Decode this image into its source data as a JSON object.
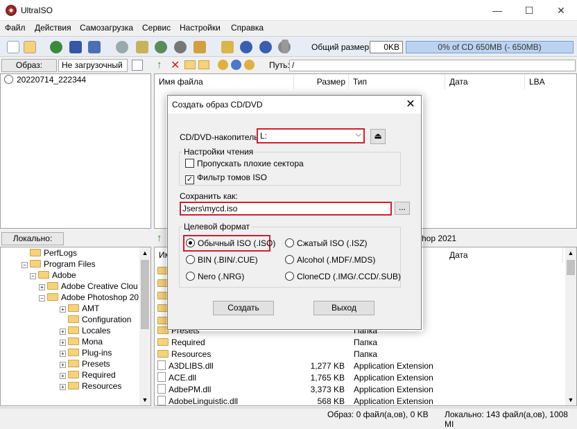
{
  "window": {
    "title": "UltraISO",
    "minimize": "—",
    "maximize": "☐",
    "close": "✕"
  },
  "menu": [
    "Файл",
    "Действия",
    "Самозагрузка",
    "Сервис",
    "Настройки",
    "Справка"
  ],
  "toolbar": {
    "size_label": "Общий размер:",
    "size_value": "0KB",
    "progress_text": "0% of CD 650MB (- 650MB)"
  },
  "image_bar": {
    "label": "Образ:",
    "value": "Не загрузочный"
  },
  "path_bar": {
    "label": "Путь:",
    "value": "/"
  },
  "left_tree": {
    "root": "20220714_222344"
  },
  "right_columns": [
    "Имя файла",
    "Размер",
    "Тип",
    "Дата",
    "LBA"
  ],
  "local": {
    "label": "Локально:",
    "tree": [
      {
        "label": "PerfLogs",
        "expander": ""
      },
      {
        "label": "Program Files",
        "expander": "−"
      },
      {
        "label": "Adobe",
        "expander": "−"
      },
      {
        "label": "Adobe Creative Clou",
        "expander": "+"
      },
      {
        "label": "Adobe Photoshop 20",
        "expander": "−"
      },
      {
        "label": "AMT",
        "expander": "+"
      },
      {
        "label": "Configuration",
        "expander": ""
      },
      {
        "label": "Locales",
        "expander": "+"
      },
      {
        "label": "Mona",
        "expander": "+"
      },
      {
        "label": "Plug-ins",
        "expander": "+"
      },
      {
        "label": "Presets",
        "expander": "+"
      },
      {
        "label": "Required",
        "expander": "+"
      },
      {
        "label": "Resources",
        "expander": "+"
      }
    ],
    "path_partial": "hop 2021",
    "columns": [
      "Им",
      "Дата"
    ],
    "files": [
      {
        "name": "Presets",
        "size": "",
        "type": "Папка",
        "icon": "folder"
      },
      {
        "name": "Required",
        "size": "",
        "type": "Папка",
        "icon": "folder"
      },
      {
        "name": "Resources",
        "size": "",
        "type": "Папка",
        "icon": "folder"
      },
      {
        "name": "A3DLIBS.dll",
        "size": "1,277 KB",
        "type": "Application Extension",
        "icon": "file"
      },
      {
        "name": "ACE.dll",
        "size": "1,765 KB",
        "type": "Application Extension",
        "icon": "file"
      },
      {
        "name": "AdbePM.dll",
        "size": "3,373 KB",
        "type": "Application Extension",
        "icon": "file"
      },
      {
        "name": "AdobeLinguistic.dll",
        "size": "568 KB",
        "type": "Application Extension",
        "icon": "file"
      }
    ]
  },
  "status": {
    "image": "Образ: 0 файл(а,ов), 0 KB",
    "local": "Локально: 143 файл(а,ов), 1008 MI"
  },
  "dialog": {
    "title": "Создать образ CD/DVD",
    "close": "✕",
    "drive_label": "CD/DVD-накопитель:",
    "drive_value": "L:",
    "read_settings": {
      "label": "Настройки чтения",
      "skip_bad": {
        "label": "Пропускать плохие сектора",
        "checked": false
      },
      "iso_filter": {
        "label": "Фильтр томов ISO",
        "checked": true
      }
    },
    "save_as_label": "Сохранить как:",
    "save_as_value": "Jsers\\mycd.iso",
    "browse": "...",
    "format": {
      "label": "Целевой формат",
      "options": [
        {
          "label": "Обычный ISO (.ISO)",
          "selected": true
        },
        {
          "label": "Сжатый ISO (.ISZ)",
          "selected": false
        },
        {
          "label": "BIN (.BIN/.CUE)",
          "selected": false
        },
        {
          "label": "Alcohol (.MDF/.MDS)",
          "selected": false
        },
        {
          "label": "Nero (.NRG)",
          "selected": false
        },
        {
          "label": "CloneCD (.IMG/.CCD/.SUB)",
          "selected": false
        }
      ]
    },
    "create_button": "Создать",
    "exit_button": "Выход"
  },
  "colors": {
    "highlight_red": "#d01f2e",
    "progress_fill": "#bcd3f0"
  }
}
